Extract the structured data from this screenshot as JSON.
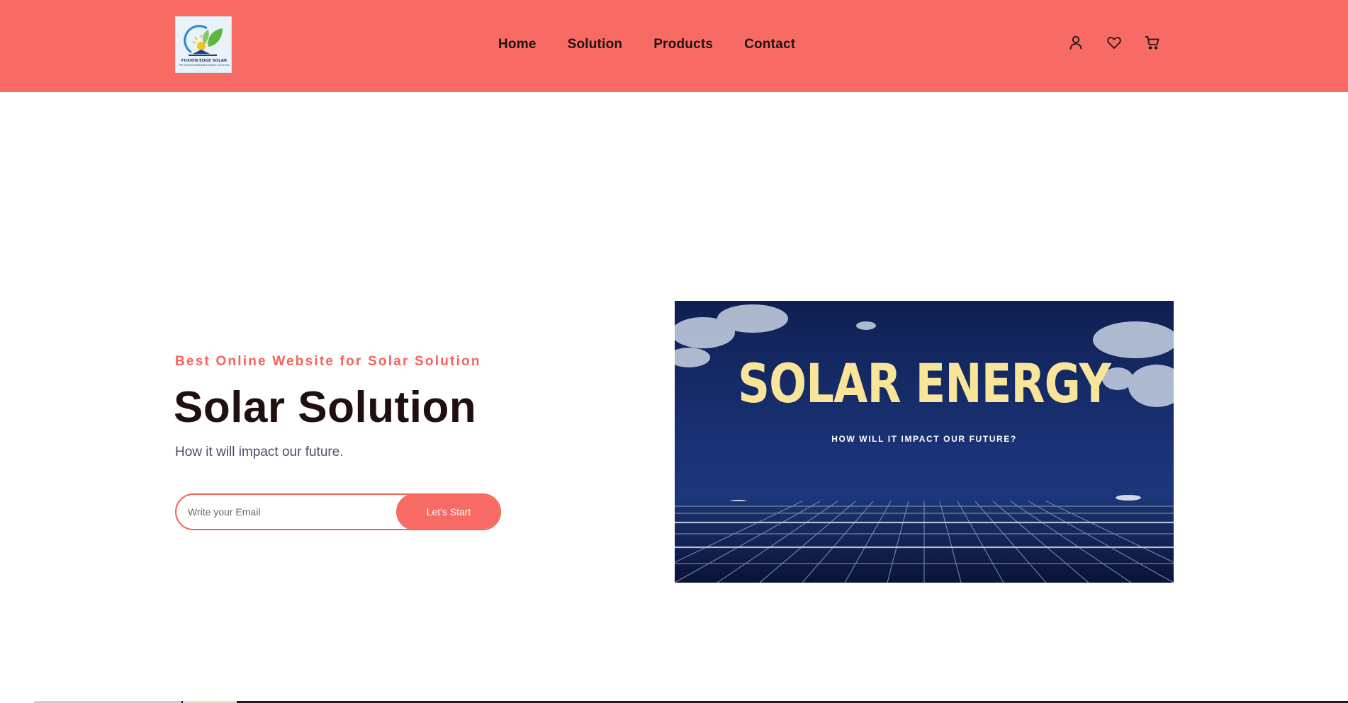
{
  "header": {
    "bg_color": "#f76b64",
    "logo": {
      "brand": "FUSION EDGE SOLAR",
      "tagline": "THE ULTIMATE RENEWABLE ENERGY SOLUTIONS"
    },
    "nav": [
      {
        "label": "Home"
      },
      {
        "label": "Solution"
      },
      {
        "label": "Products"
      },
      {
        "label": "Contact"
      }
    ],
    "icons": [
      "user-icon",
      "heart-icon",
      "cart-icon"
    ]
  },
  "hero": {
    "kicker": "Best Online Website for Solar Solution",
    "title": "Solar Solution",
    "subtitle": "How it will impact our future.",
    "email_placeholder": "Write your Email",
    "button_label": "Let's Start",
    "accent_color": "#f5625b"
  },
  "hero_image": {
    "headline": "SOLAR ENERGY",
    "subheadline": "HOW WILL IT IMPACT OUR FUTURE?",
    "headline_color": "#f8e59a"
  }
}
